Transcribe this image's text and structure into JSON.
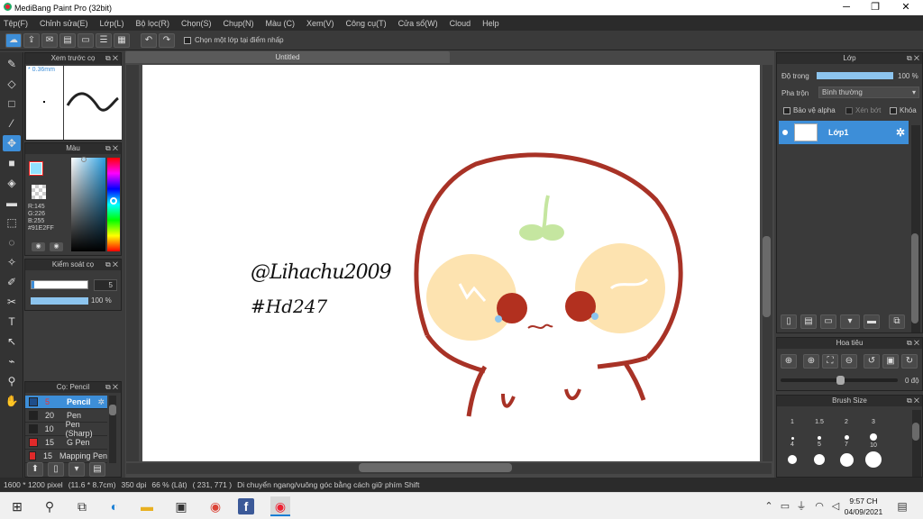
{
  "window": {
    "title": "MediBang Paint Pro (32bit)",
    "min": "─",
    "max": "❐",
    "close": "✕"
  },
  "menu": [
    "Tệp(F)",
    "Chỉnh sửa(E)",
    "Lớp(L)",
    "Bộ lọc(R)",
    "Chọn(S)",
    "Chụp(N)",
    "Màu (C)",
    "Xem(V)",
    "Công cụ(T)",
    "Cửa sổ(W)",
    "Cloud",
    "Help"
  ],
  "toolbar": {
    "checkbox_label": "Chọn một lớp tại điểm nhấp"
  },
  "brush_preview": {
    "title": "Xem trước cọ",
    "size": "* 0.36mm"
  },
  "color": {
    "title": "Màu",
    "r": "R:145",
    "g": "G:226",
    "b": "B:255",
    "hex": "#91E2FF",
    "fg": "#91e2ff"
  },
  "control": {
    "title": "Kiểm soát cọ",
    "size_value": "5",
    "opacity": "100 %"
  },
  "brush": {
    "title": "Cọ: Pencil",
    "items": [
      {
        "size": "5",
        "name": "Pencil",
        "color": "#1f4e8a",
        "selected": true
      },
      {
        "size": "20",
        "name": "Pen",
        "color": "#222222",
        "selected": false
      },
      {
        "size": "10",
        "name": "Pen (Sharp)",
        "color": "#222222",
        "selected": false
      },
      {
        "size": "15",
        "name": "G Pen",
        "color": "#e02a2a",
        "selected": false
      },
      {
        "size": "15",
        "name": "Mapping Pen",
        "color": "#e02a2a",
        "selected": false
      }
    ]
  },
  "canvas": {
    "tab": "Untitled",
    "signature_line1": "@Lihachu2009",
    "signature_line2": "#Hd247"
  },
  "layer": {
    "title": "Lớp",
    "opacity_label": "Độ trong",
    "opacity_value": "100 %",
    "blend_label": "Pha trộn",
    "blend_value": "Bình thường",
    "protect_alpha": "Bảo vệ alpha",
    "clipping": "Xén bớt",
    "lock": "Khóa",
    "layer_name": "Lớp1"
  },
  "navigator": {
    "title": "Hoa tiêu",
    "angle": "0 độ"
  },
  "brush_size": {
    "title": "Brush Size",
    "sizes": [
      "1",
      "1.5",
      "2",
      "3",
      "4",
      "5",
      "7",
      "10"
    ]
  },
  "status": {
    "dimensions": "1600 * 1200 pixel",
    "physical": "(11.6 * 8.7cm)",
    "dpi": "350 dpi",
    "zoom": "66 % (Lật)",
    "coords": "( 231, 771 )",
    "hint": "Di chuyển ngang/vuông góc bằng cách giữ phím Shift"
  },
  "taskbar": {
    "time": "9:57 CH",
    "date": "04/09/2021"
  }
}
